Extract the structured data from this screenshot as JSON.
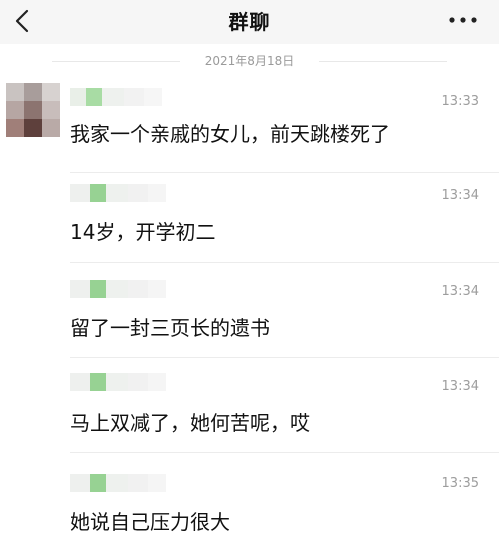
{
  "header": {
    "title": "群聊",
    "back_icon": "chevron-left-icon",
    "more_icon": "more-dots-icon"
  },
  "date_divider": "2021年8月18日",
  "messages": [
    {
      "time": "13:33",
      "text": "我家一个亲戚的女儿，前天跳楼死了"
    },
    {
      "time": "13:34",
      "text": "14岁，开学初二"
    },
    {
      "time": "13:34",
      "text": "留了一封三页长的遗书"
    },
    {
      "time": "13:34",
      "text": "马上双减了，她何苦呢，哎"
    },
    {
      "time": "13:35",
      "text": "她说自己压力很大"
    }
  ],
  "colors": {
    "header_bg": "#f6f6f6",
    "name_accent": "#9ed69a",
    "time": "#9d9d9d"
  }
}
